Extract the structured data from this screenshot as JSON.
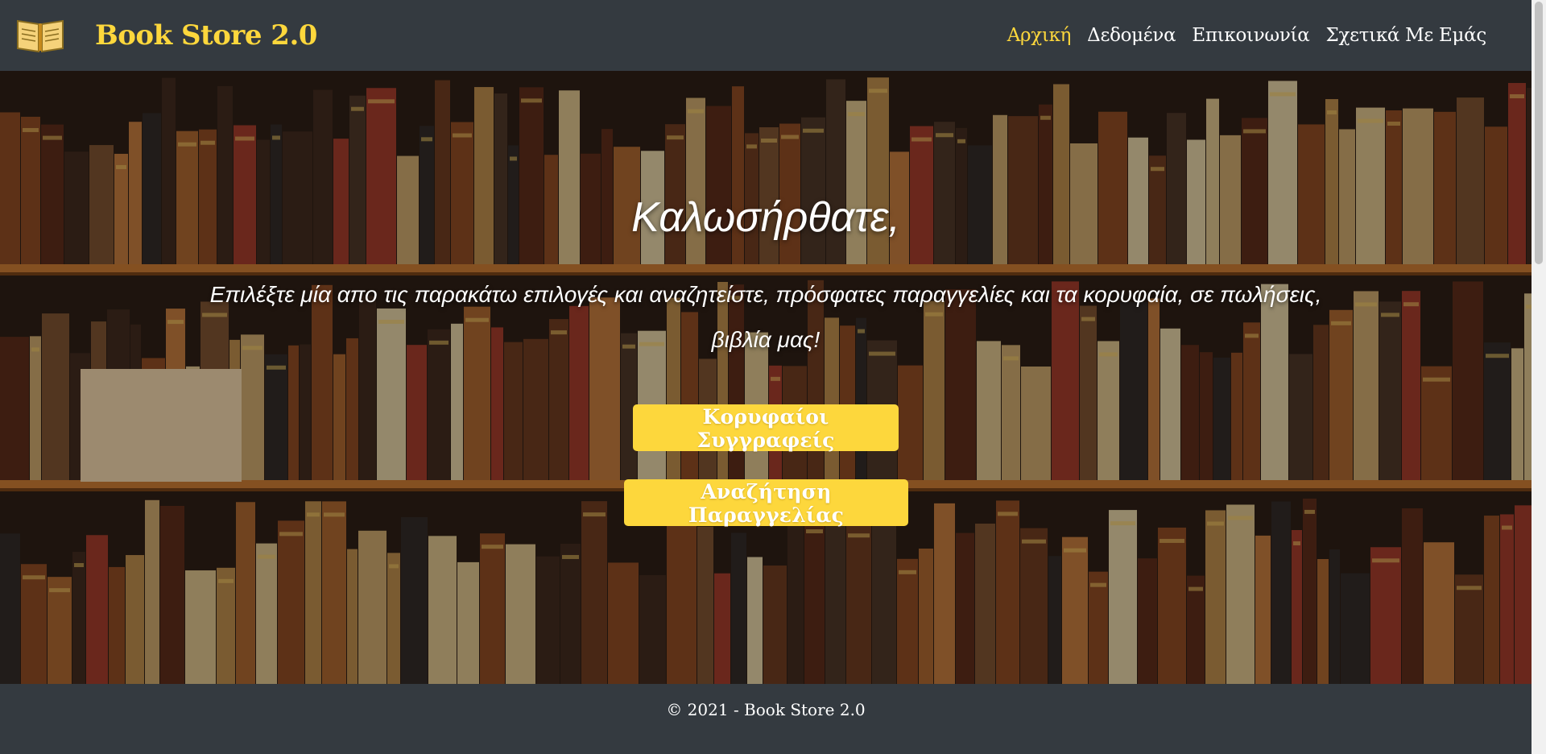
{
  "header": {
    "brand": "Book Store 2.0",
    "logo_icon": "open-book-icon",
    "nav": [
      {
        "label": "Αρχική",
        "active": true
      },
      {
        "label": "Δεδομένα",
        "active": false
      },
      {
        "label": "Επικοινωνία",
        "active": false
      },
      {
        "label": "Σχετικά Με Εμάς",
        "active": false
      }
    ]
  },
  "hero": {
    "title": "Καλωσήρθατε,",
    "subtitle": "Επιλέξτε μία απο τις παρακάτω επιλογές και αναζητείστε, πρόσφατες παραγγελίες και τα κορυφαία, σε πωλήσεις, βιβλία μας!",
    "buttons": {
      "authors": "Κορυφαίοι Συγγραφείς",
      "order_search": "Αναζήτηση Παραγγελίας"
    }
  },
  "footer": {
    "text": "© 2021 - Book Store 2.0"
  },
  "colors": {
    "accent": "#fdd73c",
    "navbar": "#343a40",
    "text_light": "#ffffff"
  }
}
